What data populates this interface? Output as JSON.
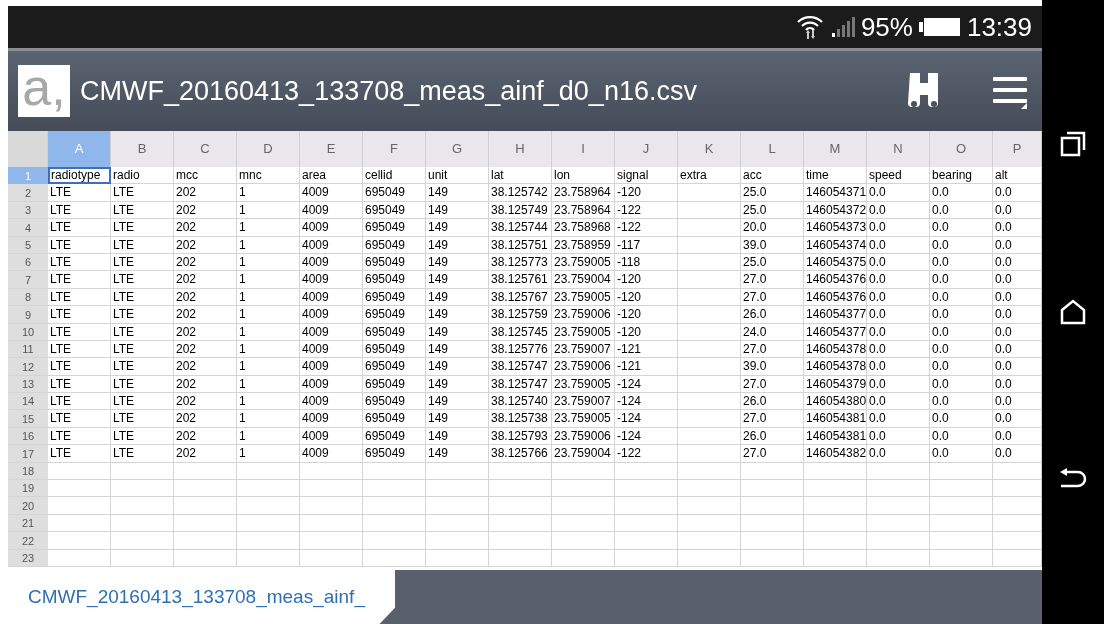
{
  "status_bar": {
    "battery": "95%",
    "time": "13:39"
  },
  "app_bar": {
    "logo": "a,",
    "title": "CMWF_20160413_133708_meas_ainf_d0_n16.csv"
  },
  "columns": [
    {
      "label": "A",
      "selected": true
    },
    {
      "label": "B",
      "selected": false
    },
    {
      "label": "C",
      "selected": false
    },
    {
      "label": "D",
      "selected": false
    },
    {
      "label": "E",
      "selected": false
    },
    {
      "label": "F",
      "selected": false
    },
    {
      "label": "G",
      "selected": false
    },
    {
      "label": "H",
      "selected": false
    },
    {
      "label": "I",
      "selected": false
    },
    {
      "label": "J",
      "selected": false
    },
    {
      "label": "K",
      "selected": false
    },
    {
      "label": "L",
      "selected": false
    },
    {
      "label": "M",
      "selected": false
    },
    {
      "label": "N",
      "selected": false
    },
    {
      "label": "O",
      "selected": false
    },
    {
      "label": "P",
      "selected": false
    }
  ],
  "rows": [
    {
      "number": "1",
      "selected": true,
      "cells": [
        "radiotype",
        "radio",
        "mcc",
        "mnc",
        "area",
        "cellid",
        "unit",
        "lat",
        "lon",
        "signal",
        "extra",
        "acc",
        "time",
        "speed",
        "bearing",
        "alt"
      ]
    },
    {
      "number": "2",
      "selected": false,
      "cells": [
        "LTE",
        "LTE",
        "202",
        "1",
        "4009",
        "695049",
        "149",
        "38.125742",
        "23.758964",
        "-120",
        "",
        "25.0",
        "146054371",
        "0.0",
        "0.0",
        "0.0"
      ]
    },
    {
      "number": "3",
      "selected": false,
      "cells": [
        "LTE",
        "LTE",
        "202",
        "1",
        "4009",
        "695049",
        "149",
        "38.125749",
        "23.758964",
        "-122",
        "",
        "25.0",
        "146054372",
        "0.0",
        "0.0",
        "0.0"
      ]
    },
    {
      "number": "4",
      "selected": false,
      "cells": [
        "LTE",
        "LTE",
        "202",
        "1",
        "4009",
        "695049",
        "149",
        "38.125744",
        "23.758968",
        "-122",
        "",
        "20.0",
        "146054373",
        "0.0",
        "0.0",
        "0.0"
      ]
    },
    {
      "number": "5",
      "selected": false,
      "cells": [
        "LTE",
        "LTE",
        "202",
        "1",
        "4009",
        "695049",
        "149",
        "38.125751",
        "23.758959",
        "-117",
        "",
        "39.0",
        "146054374",
        "0.0",
        "0.0",
        "0.0"
      ]
    },
    {
      "number": "6",
      "selected": false,
      "cells": [
        "LTE",
        "LTE",
        "202",
        "1",
        "4009",
        "695049",
        "149",
        "38.125773",
        "23.759005",
        "-118",
        "",
        "25.0",
        "146054375",
        "0.0",
        "0.0",
        "0.0"
      ]
    },
    {
      "number": "7",
      "selected": false,
      "cells": [
        "LTE",
        "LTE",
        "202",
        "1",
        "4009",
        "695049",
        "149",
        "38.125761",
        "23.759004",
        "-120",
        "",
        "27.0",
        "146054376",
        "0.0",
        "0.0",
        "0.0"
      ]
    },
    {
      "number": "8",
      "selected": false,
      "cells": [
        "LTE",
        "LTE",
        "202",
        "1",
        "4009",
        "695049",
        "149",
        "38.125767",
        "23.759005",
        "-120",
        "",
        "27.0",
        "146054376",
        "0.0",
        "0.0",
        "0.0"
      ]
    },
    {
      "number": "9",
      "selected": false,
      "cells": [
        "LTE",
        "LTE",
        "202",
        "1",
        "4009",
        "695049",
        "149",
        "38.125759",
        "23.759006",
        "-120",
        "",
        "26.0",
        "146054377",
        "0.0",
        "0.0",
        "0.0"
      ]
    },
    {
      "number": "10",
      "selected": false,
      "cells": [
        "LTE",
        "LTE",
        "202",
        "1",
        "4009",
        "695049",
        "149",
        "38.125745",
        "23.759005",
        "-120",
        "",
        "24.0",
        "146054377",
        "0.0",
        "0.0",
        "0.0"
      ]
    },
    {
      "number": "11",
      "selected": false,
      "cells": [
        "LTE",
        "LTE",
        "202",
        "1",
        "4009",
        "695049",
        "149",
        "38.125776",
        "23.759007",
        "-121",
        "",
        "27.0",
        "146054378",
        "0.0",
        "0.0",
        "0.0"
      ]
    },
    {
      "number": "12",
      "selected": false,
      "cells": [
        "LTE",
        "LTE",
        "202",
        "1",
        "4009",
        "695049",
        "149",
        "38.125747",
        "23.759006",
        "-121",
        "",
        "39.0",
        "146054378",
        "0.0",
        "0.0",
        "0.0"
      ]
    },
    {
      "number": "13",
      "selected": false,
      "cells": [
        "LTE",
        "LTE",
        "202",
        "1",
        "4009",
        "695049",
        "149",
        "38.125747",
        "23.759005",
        "-124",
        "",
        "27.0",
        "146054379",
        "0.0",
        "0.0",
        "0.0"
      ]
    },
    {
      "number": "14",
      "selected": false,
      "cells": [
        "LTE",
        "LTE",
        "202",
        "1",
        "4009",
        "695049",
        "149",
        "38.125740",
        "23.759007",
        "-124",
        "",
        "26.0",
        "146054380",
        "0.0",
        "0.0",
        "0.0"
      ]
    },
    {
      "number": "15",
      "selected": false,
      "cells": [
        "LTE",
        "LTE",
        "202",
        "1",
        "4009",
        "695049",
        "149",
        "38.125738",
        "23.759005",
        "-124",
        "",
        "27.0",
        "146054381",
        "0.0",
        "0.0",
        "0.0"
      ]
    },
    {
      "number": "16",
      "selected": false,
      "cells": [
        "LTE",
        "LTE",
        "202",
        "1",
        "4009",
        "695049",
        "149",
        "38.125793",
        "23.759006",
        "-124",
        "",
        "26.0",
        "146054381",
        "0.0",
        "0.0",
        "0.0"
      ]
    },
    {
      "number": "17",
      "selected": false,
      "cells": [
        "LTE",
        "LTE",
        "202",
        "1",
        "4009",
        "695049",
        "149",
        "38.125766",
        "23.759004",
        "-122",
        "",
        "27.0",
        "146054382",
        "0.0",
        "0.0",
        "0.0"
      ]
    },
    {
      "number": "18",
      "selected": false
    },
    {
      "number": "19",
      "selected": false
    },
    {
      "number": "20",
      "selected": false
    },
    {
      "number": "21",
      "selected": false
    },
    {
      "number": "22",
      "selected": false
    },
    {
      "number": "23",
      "selected": false
    }
  ],
  "sheet_tabs": [
    {
      "label": "CMWF_20160413_133708_meas_ainf_",
      "selected": true
    }
  ]
}
